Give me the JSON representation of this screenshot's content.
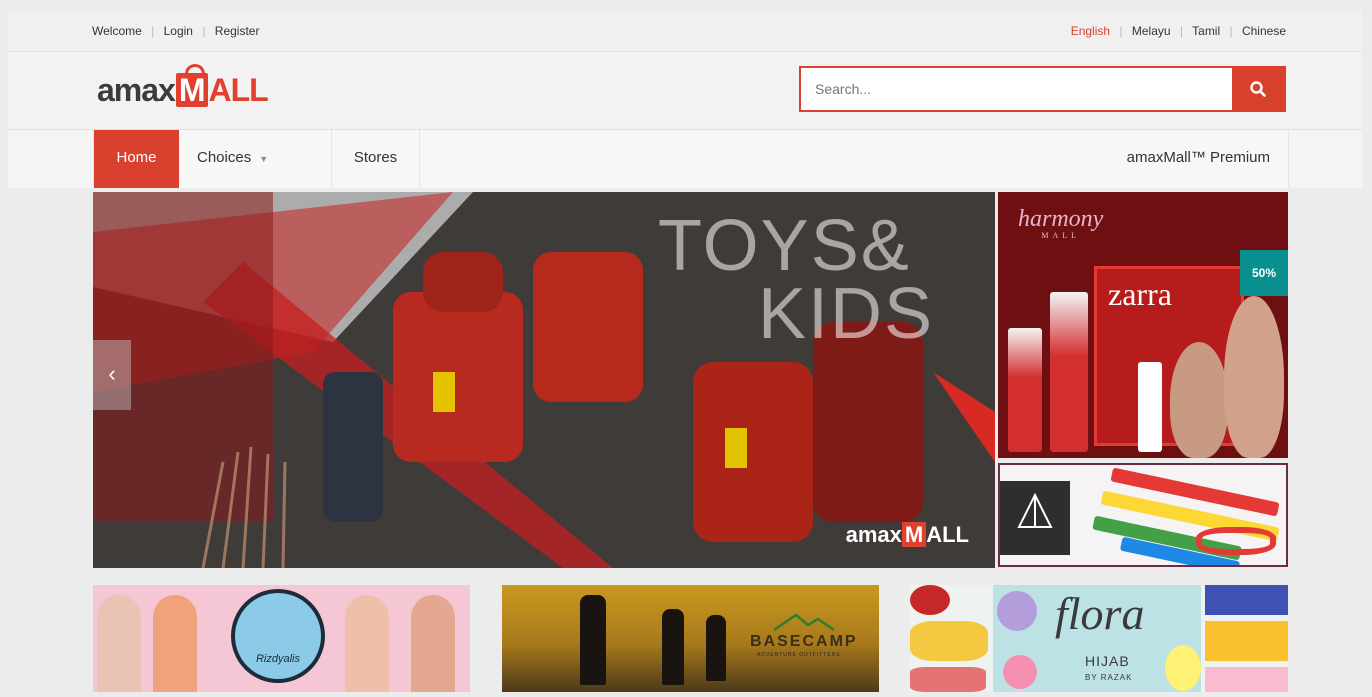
{
  "topbar": {
    "welcome": "Welcome",
    "login": "Login",
    "register": "Register",
    "languages": [
      "English",
      "Melayu",
      "Tamil",
      "Chinese"
    ],
    "active_language": "English",
    "divider": "|"
  },
  "header": {
    "logo_prefix": "amax",
    "logo_mark": "M",
    "logo_suffix": "ALL",
    "search_placeholder": "Search...",
    "search_icon": "search-icon"
  },
  "nav": {
    "home": "Home",
    "choices": "Choices",
    "choices_caret": "▼",
    "stores": "Stores",
    "premium": "amaxMall™ Premium"
  },
  "hero": {
    "title_line1": "TOYS&",
    "title_line2": "KIDS",
    "brand_prefix": "amax",
    "brand_mark": "M",
    "brand_suffix": "ALL",
    "prev_arrow": "‹"
  },
  "side_banner_1": {
    "brand": "harmony",
    "brand_sub": "MALL",
    "product": "zarra",
    "badge": "50%"
  },
  "promo_bottom": {
    "hijab_brand": "Rizdyalis",
    "basecamp_title": "BASECAMP",
    "basecamp_sub": "ADVENTURE OUTFITTERS",
    "flora_title": "flora",
    "flora_hijab": "HIJAB",
    "flora_by": "BY RAZAK"
  },
  "colors": {
    "accent": "#d9412e",
    "background": "#ececec",
    "text": "#333333"
  }
}
